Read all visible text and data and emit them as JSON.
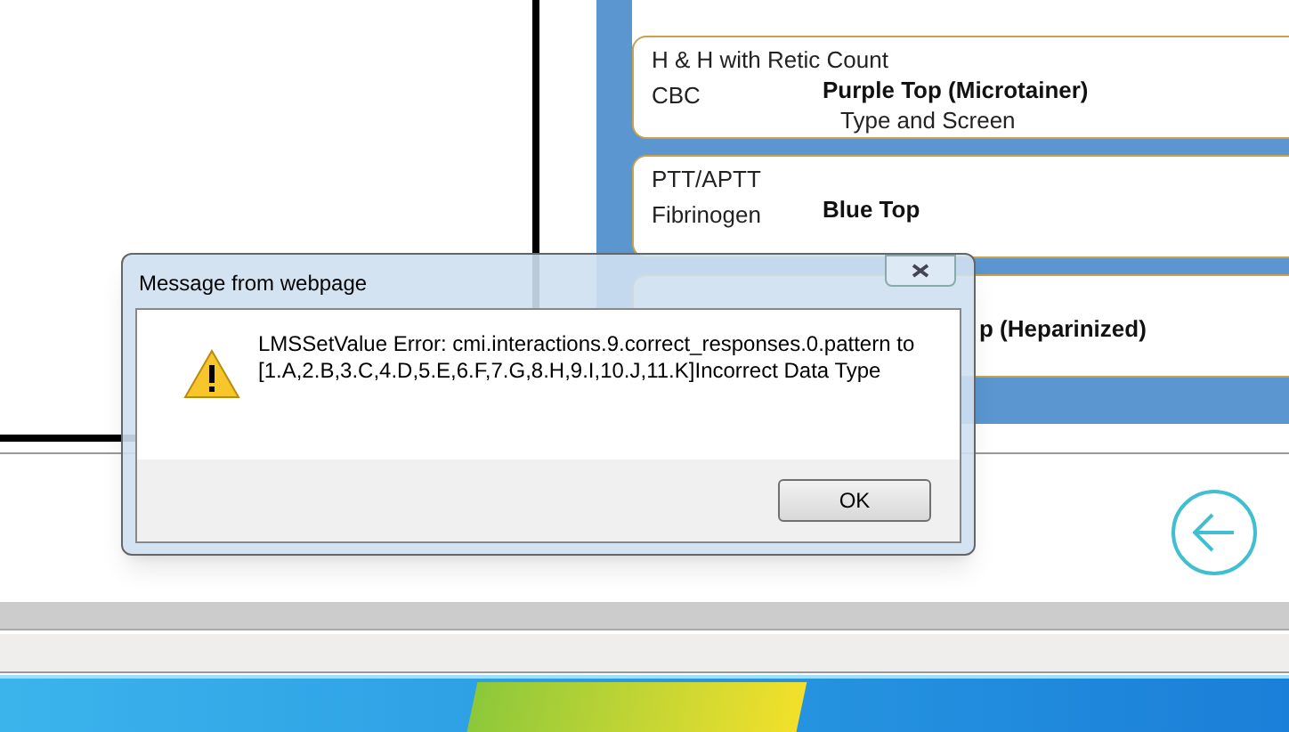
{
  "cards": [
    {
      "left_lines": [
        "H & H with Retic Count",
        "CBC"
      ],
      "tube": "Purple Top (Microtainer)",
      "extra": "Type and Screen"
    },
    {
      "left_lines": [
        "PTT/APTT",
        "Fibrinogen"
      ],
      "tube": "Blue Top"
    },
    {
      "tube": "p (Heparinized)"
    }
  ],
  "dialog": {
    "title": "Message from webpage",
    "message": "LMSSetValue Error: cmi.interactions.9.correct_responses.0.pattern to [1.A,2.B,3.C,4.D,5.E,6.F,7.G,8.H,9.I,10.J,11.K]Incorrect Data Type",
    "button": "OK"
  }
}
